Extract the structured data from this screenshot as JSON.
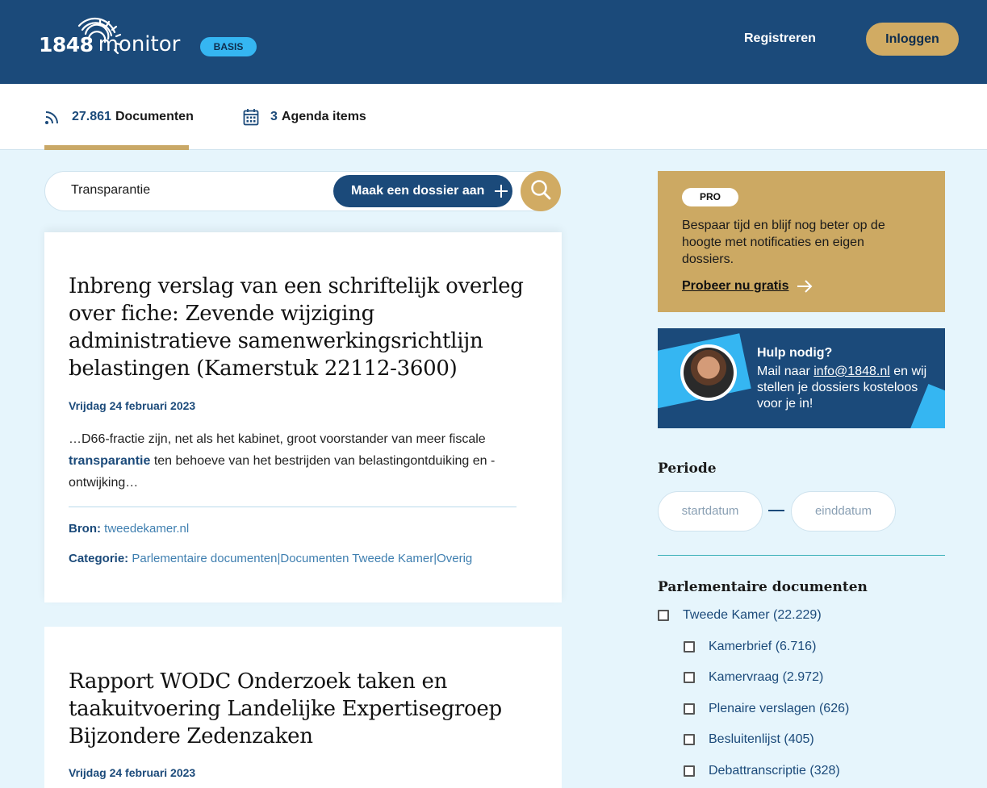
{
  "header": {
    "logo_number": "1848",
    "logo_word": "monitor",
    "plan_badge": "BASIS",
    "register_label": "Registreren",
    "login_label": "Inloggen"
  },
  "tabs": {
    "documents": {
      "count": "27.861",
      "label": "Documenten",
      "icon": "rss-icon"
    },
    "agenda": {
      "count": "3",
      "label": "Agenda items",
      "icon": "calendar-icon"
    }
  },
  "search": {
    "value": "Transparantie",
    "dossier_button": "Maak een dossier aan"
  },
  "results": [
    {
      "title": "Inbreng verslag van een schriftelijk overleg over fiche: Zevende wijziging administratieve samenwerkingsrichtlijn belastingen (Kamerstuk 22112-3600)",
      "date": "Vrijdag 24 februari 2023",
      "snippet_before": "…D66-fractie zijn, net als het kabinet, groot voorstander van meer fiscale ",
      "snippet_highlight": "transparantie",
      "snippet_after": " ten behoeve van het bestrijden van belastingontduiking en -ontwijking…",
      "source_label": "Bron:",
      "source_value": "tweedekamer.nl",
      "category_label": "Categorie:",
      "category_value": "Parlementaire documenten|Documenten Tweede Kamer|Overig"
    },
    {
      "title": "Rapport WODC Onderzoek taken en taakuitvoering Landelijke Expertisegroep Bijzondere Zedenzaken",
      "date": "Vrijdag 24 februari 2023"
    }
  ],
  "pro_box": {
    "badge": "PRO",
    "text": "Bespaar tijd en blijf nog beter op de hoogte met notificaties en eigen dossiers.",
    "link": "Probeer nu gratis"
  },
  "help_box": {
    "title": "Hulp nodig?",
    "text_before": "Mail naar ",
    "email": "info@1848.nl",
    "text_after": " en wij stellen je dossiers kosteloos voor je in!"
  },
  "period": {
    "heading": "Periode",
    "start_placeholder": "startdatum",
    "end_placeholder": "einddatum"
  },
  "filters": {
    "heading": "Parlementaire documenten",
    "parent": {
      "label": "Tweede Kamer (22.229)",
      "checked": false
    },
    "children": [
      {
        "label": "Kamerbrief (6.716)",
        "checked": false
      },
      {
        "label": "Kamervraag (2.972)",
        "checked": false
      },
      {
        "label": "Plenaire verslagen (626)",
        "checked": false
      },
      {
        "label": "Besluitenlijst (405)",
        "checked": false
      },
      {
        "label": "Debattranscriptie (328)",
        "checked": false
      }
    ]
  },
  "colors": {
    "navy": "#1b4a7a",
    "gold": "#d1ab63",
    "sky": "#35b6f2",
    "page_background": "#e6f5fc"
  }
}
